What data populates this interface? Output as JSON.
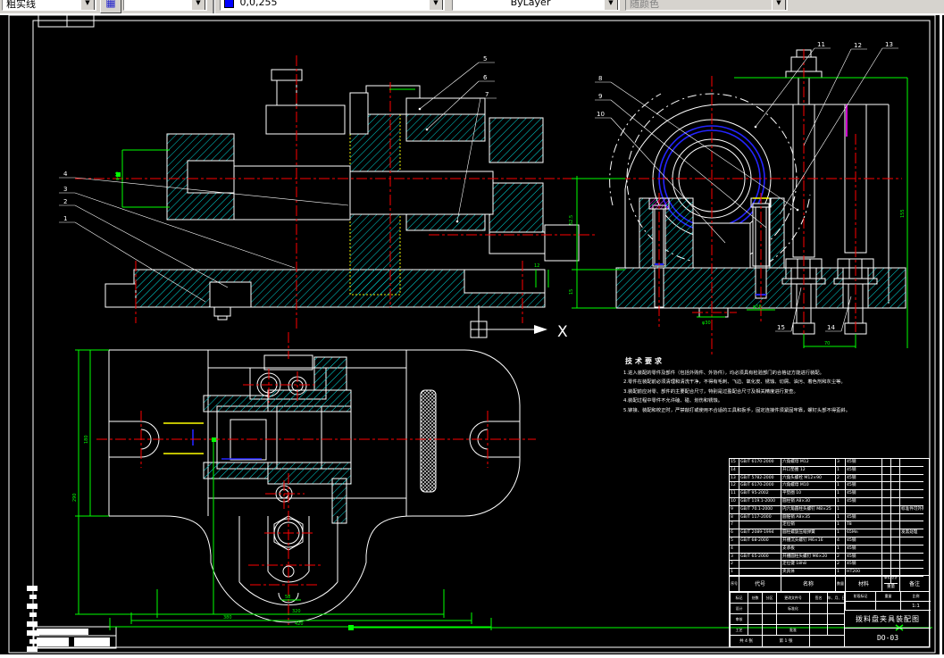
{
  "toolbar": {
    "combo1": "粗实线",
    "layer": "",
    "color_value": "0,0,255",
    "linetype": "ByLayer",
    "plotstyle": "随颜色",
    "layers_icon": "▦",
    "arrow": "▼"
  },
  "callouts": {
    "c1": "1",
    "c2": "2",
    "c3": "3",
    "c4": "4",
    "c5": "5",
    "c6": "6",
    "c7": "7",
    "c8": "8",
    "c9": "9",
    "c10": "10",
    "c11": "11",
    "c12": "12",
    "c13": "13",
    "c14": "14",
    "c15": "15",
    "view_label": "X"
  },
  "dims": {
    "lv_bore": "φ40",
    "lv_step": "12",
    "rv_h1": "52.5",
    "rv_h2": "15",
    "rv_right": "155",
    "rv_w70": "70",
    "rv_d16": "φ16",
    "rv_d30": "φ30",
    "pv_l1": "180",
    "pv_l2": "290",
    "pv_b1": "58",
    "pv_b2": "320",
    "pv_b3": "380",
    "pv_b4": "420"
  },
  "tech_requirements": {
    "title": "技术要求",
    "lines": [
      "1.进入装配的零件及部件（包括外购件、外协件），均必须具有检验部门的合格证方能进行装配。",
      "2.零件在装配前必须清理和清洗干净，不得有毛刺、飞边、氧化皮、锈蚀、切屑、油污、着色剂和灰尘等。",
      "3.装配前应对零、部件的主要配合尺寸，特别是过盈配合尺寸及相关精度进行复查。",
      "4.装配过程中零件不允许磕、碰、划伤和锈蚀。",
      "5.铆接、装配和校正时，严禁敲打或使用不合适的工具和扳手，固定连接件须紧固牢靠，螺钉头部不得歪斜。"
    ]
  },
  "bom": {
    "headers": {
      "xh": "序号",
      "dh": "代号",
      "mc": "名称",
      "sl": "数量",
      "cl": "材料",
      "dj": "单件",
      "zj": "总计",
      "zl": "重量",
      "bz": "备注"
    },
    "rows": [
      [
        "15",
        "GB/T 6170-2000",
        "六角螺母 M12",
        "3",
        "45钢",
        "",
        "",
        ""
      ],
      [
        "14",
        "",
        "开口垫圈 12",
        "1",
        "45钢",
        "",
        "",
        ""
      ],
      [
        "13",
        "GB/T 5782-2000",
        "六角头螺栓 M12×90",
        "2",
        "45钢",
        "",
        "",
        ""
      ],
      [
        "12",
        "GB/T 6170-2000",
        "六角螺母 M10",
        "1",
        "45钢",
        "",
        "",
        ""
      ],
      [
        "11",
        "GB/T 95-2002",
        "平垫圈 10",
        "1",
        "45钢",
        "",
        "",
        ""
      ],
      [
        "10",
        "GB/T 119.1-2000",
        "圆柱销 A8×30",
        "1",
        "45钢",
        "",
        "",
        ""
      ],
      [
        "9",
        "GB/T 70.1-2000",
        "内六角圆柱头螺钉 M8×25",
        "1",
        "",
        "",
        "",
        "标准件可外购"
      ],
      [
        "8",
        "GB/T 117-2000",
        "圆锥销 A8×35",
        "1",
        "45钢",
        "",
        "",
        ""
      ],
      [
        "7",
        "",
        "定位销",
        "1",
        "T8",
        "",
        "",
        ""
      ],
      [
        "6",
        "GB/T 2089-1994",
        "圆柱螺旋压缩弹簧",
        "1",
        "65Mn",
        "",
        "",
        "发黑处理"
      ],
      [
        "5",
        "GB/T 68-2000",
        "开槽沉头螺钉 M6×16",
        "4",
        "45钢",
        "",
        "",
        ""
      ],
      [
        "4",
        "",
        "支承板",
        "1",
        "45钢",
        "",
        "",
        ""
      ],
      [
        "3",
        "GB/T 65-2000",
        "开槽圆柱头螺钉 M6×20",
        "2",
        "45钢",
        "",
        "",
        ""
      ],
      [
        "2",
        "",
        "定位键 18h8",
        "2",
        "45钢",
        "",
        "",
        ""
      ],
      [
        "1",
        "",
        "夹具体",
        "1",
        "HT200",
        "",
        "",
        ""
      ]
    ]
  },
  "title_block": {
    "marks_row": [
      "标记",
      "处数",
      "分区",
      "更改文件号",
      "签名",
      "年、月、日"
    ],
    "design": "设计",
    "standardize": "标准化",
    "check": "审核",
    "process": "工艺",
    "approve": "批准",
    "stage": "阶段标记",
    "weight": "重量",
    "scale": "比例",
    "scale_value": "1:1",
    "sheets_total": "共 4 张",
    "sheet_no": "第 1 张",
    "title": "拨料盘夹具装配图",
    "drawing_no": "DO-03"
  }
}
